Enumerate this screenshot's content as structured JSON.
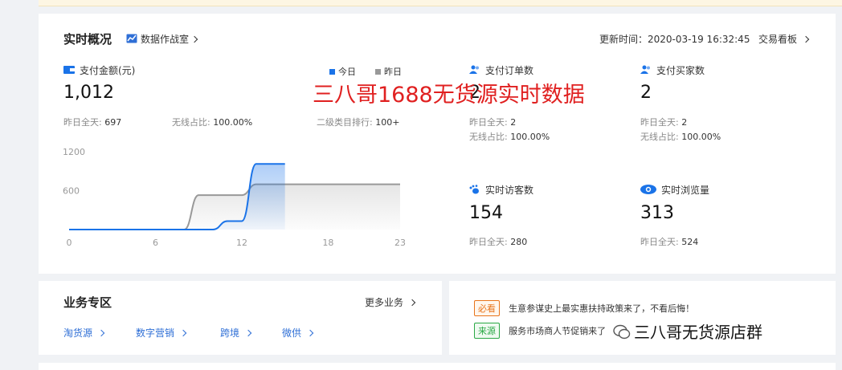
{
  "realtime": {
    "title": "实时概况",
    "war_room": "数据作战室",
    "update_time": "更新时间：2020-03-19 16:32:45",
    "trade_board": "交易看板",
    "legend_today": "今日",
    "legend_yesterday": "昨日",
    "pay_amount": {
      "label": "支付金额(元)",
      "value": "1,012",
      "yesterday_label": "昨日全天:",
      "yesterday_value": "697",
      "wireless_label": "无线占比:",
      "wireless_value": "100.00%",
      "rank_label": "二级类目排行:",
      "rank_value": "100+"
    },
    "pay_orders": {
      "label": "支付订单数",
      "value": "2",
      "yesterday_label": "昨日全天:",
      "yesterday_value": "2",
      "wireless_label": "无线占比:",
      "wireless_value": "100.00%"
    },
    "pay_buyers": {
      "label": "支付买家数",
      "value": "2",
      "yesterday_label": "昨日全天:",
      "yesterday_value": "2",
      "wireless_label": "无线占比:",
      "wireless_value": "100.00%"
    },
    "visitors": {
      "label": "实时访客数",
      "value": "154",
      "yesterday_label": "昨日全天:",
      "yesterday_value": "280"
    },
    "pageviews": {
      "label": "实时浏览量",
      "value": "313",
      "yesterday_label": "昨日全天:",
      "yesterday_value": "524"
    }
  },
  "overlay_text": "三八哥1688无货源实时数据",
  "business": {
    "title": "业务专区",
    "more": "更多业务",
    "links": [
      "淘货源",
      "数字营销",
      "跨境",
      "微供"
    ]
  },
  "news": [
    {
      "tag": "必看",
      "text": "生意参谋史上最实惠扶持政策来了，不看后悔！"
    },
    {
      "tag": "来源",
      "text": "服务市场商人节促销来了"
    }
  ],
  "watermark": "三八哥无货源店群",
  "colors": {
    "today": "#1a73e8",
    "yesterday": "#999999",
    "accent": "#2f6fd6"
  },
  "chart_data": {
    "type": "line",
    "x": [
      0,
      1,
      2,
      3,
      4,
      5,
      6,
      7,
      8,
      9,
      10,
      11,
      12,
      13,
      14,
      15,
      16,
      17,
      18,
      19,
      20,
      21,
      22,
      23
    ],
    "xticks": [
      "0",
      "6",
      "12",
      "18",
      "23"
    ],
    "yticks": [
      "1200",
      "600"
    ],
    "ylim": [
      0,
      1200
    ],
    "series": [
      {
        "name": "今日",
        "values": [
          0,
          0,
          0,
          0,
          0,
          0,
          0,
          0,
          0,
          0,
          0,
          130,
          130,
          1012,
          1012,
          1012,
          null,
          null,
          null,
          null,
          null,
          null,
          null,
          null
        ]
      },
      {
        "name": "昨日",
        "values": [
          0,
          0,
          0,
          0,
          0,
          0,
          0,
          0,
          0,
          530,
          530,
          530,
          530,
          697,
          697,
          697,
          697,
          697,
          697,
          697,
          697,
          697,
          697,
          697
        ]
      }
    ]
  }
}
